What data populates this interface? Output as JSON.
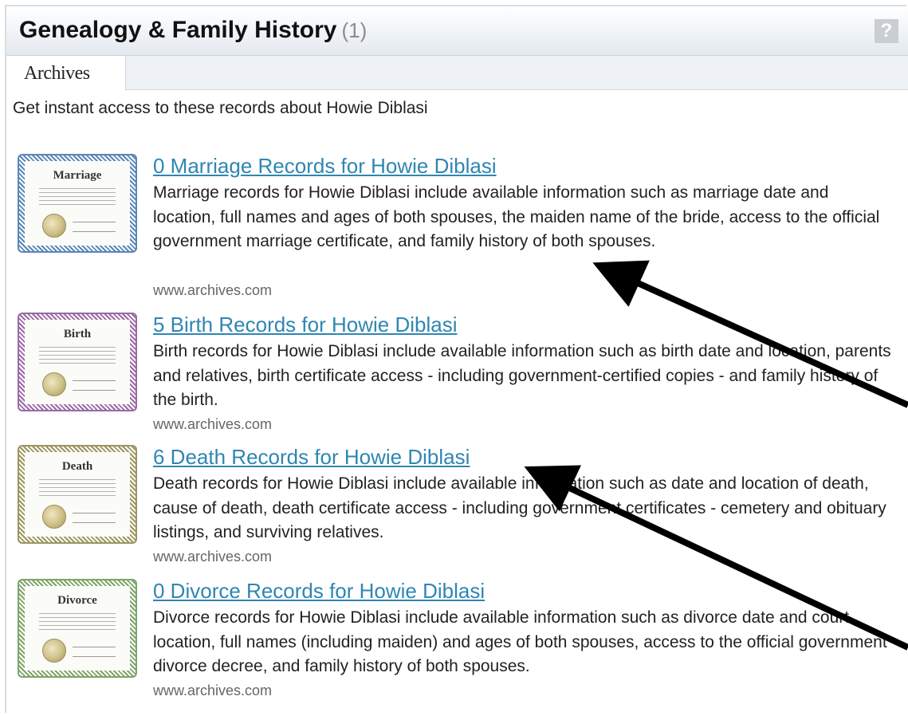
{
  "header": {
    "title": "Genealogy & Family History",
    "count": "(1)",
    "help_label": "?"
  },
  "tabs": [
    {
      "label": "Archives"
    }
  ],
  "intro": "Get instant access to these records about Howie Diblasi",
  "records": [
    {
      "cert_label": "Marriage",
      "link": "0 Marriage Records for Howie Diblasi",
      "desc": "Marriage records for Howie Diblasi include available information such as marriage date and location, full names and ages of both spouses, the maiden name of the bride, access to the official government marriage certificate, and family history of both spouses.",
      "source": "www.archives.com",
      "color": "#5b86b8"
    },
    {
      "cert_label": "Birth",
      "link": "5 Birth Records for Howie Diblasi",
      "desc": "Birth records for Howie Diblasi include available information such as birth date and location, parents and relatives, birth certificate access - including government-certified copies - and family history of the birth.",
      "source": "www.archives.com",
      "color": "#9a6aa6"
    },
    {
      "cert_label": "Death",
      "link": "6 Death Records for Howie Diblasi",
      "desc": "Death records for Howie Diblasi include available information such as date and location of death, cause of death, death certificate access - including government certificates - cemetery and obituary listings, and surviving relatives.",
      "source": "www.archives.com",
      "color": "#9b9560"
    },
    {
      "cert_label": "Divorce",
      "link": "0 Divorce Records for Howie Diblasi",
      "desc": "Divorce records for Howie Diblasi include available information such as divorce date and court location, full names (including maiden) and ages of both spouses, access to the official government divorce decree, and family history of both spouses.",
      "source": "www.archives.com",
      "color": "#7ea46a"
    }
  ],
  "annotation_color": "#000000"
}
